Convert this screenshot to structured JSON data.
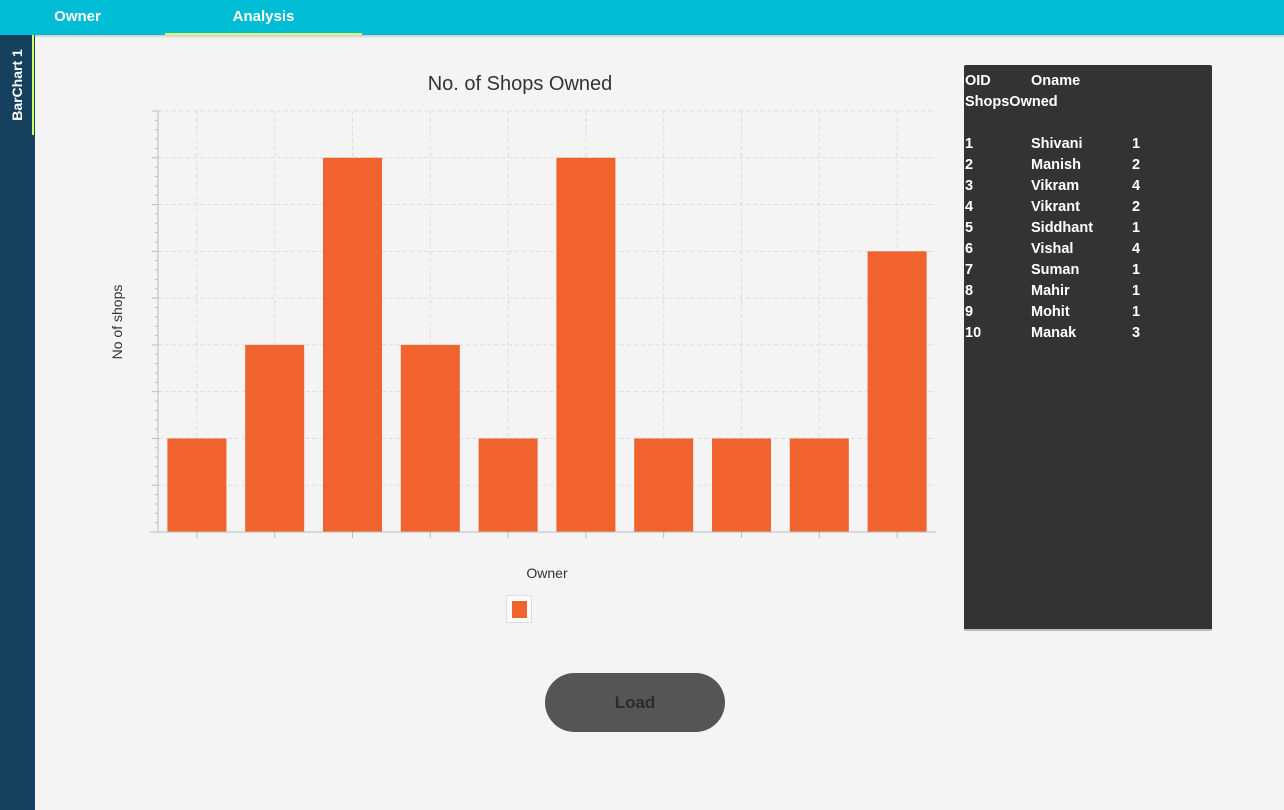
{
  "tabs": [
    {
      "label": "Owner",
      "active": false
    },
    {
      "label": "Analysis",
      "active": true
    }
  ],
  "sidebar": {
    "tab_label": "BarChart 1"
  },
  "chart_data": {
    "type": "bar",
    "title": "No. of Shops Owned",
    "xlabel": "Owner",
    "ylabel": "No of shops",
    "categories": [
      "Shivani",
      "Manish",
      "Vikram",
      "Vikrant",
      "Siddhant",
      "Vishal",
      "Suman",
      "Mahir",
      "Mohit",
      "Manak"
    ],
    "values": [
      1,
      2,
      4,
      2,
      1,
      4,
      1,
      1,
      1,
      3
    ],
    "ylim": [
      0,
      4.5
    ],
    "grid": true,
    "legend": "bottom-center",
    "tick_labels_visible": false
  },
  "colors": {
    "bar": "#f0622e",
    "topbar": "#00bcd4",
    "sidebar": "#16415e",
    "panel": "#333333",
    "accent": "#d4ff6a"
  },
  "panel": {
    "header": [
      "OID",
      "Oname",
      "ShopsOwned"
    ],
    "rows": [
      [
        "1",
        "Shivani",
        "1"
      ],
      [
        "2",
        "Manish",
        "2"
      ],
      [
        "3",
        "Vikram",
        "4"
      ],
      [
        "4",
        "Vikrant",
        "2"
      ],
      [
        "5",
        "Siddhant",
        "1"
      ],
      [
        "6",
        "Vishal",
        "4"
      ],
      [
        "7",
        "Suman",
        "1"
      ],
      [
        "8",
        "Mahir",
        "1"
      ],
      [
        "9",
        "Mohit",
        "1"
      ],
      [
        "10",
        "Manak",
        "3"
      ]
    ]
  },
  "load_button": {
    "label": "Load"
  }
}
